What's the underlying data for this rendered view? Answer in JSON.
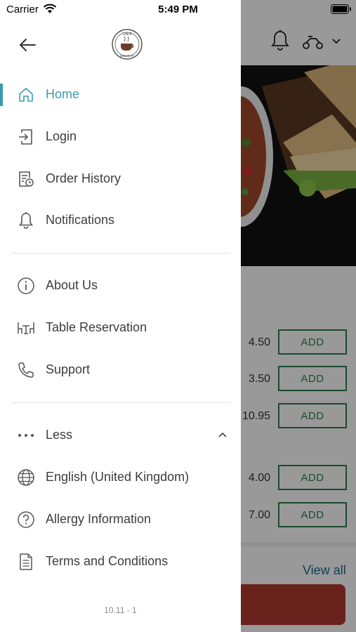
{
  "status_bar": {
    "carrier": "Carrier",
    "time": "5:49 PM"
  },
  "drawer": {
    "logo_text_top": "CAFE",
    "logo_text_bottom": "DELIGHT",
    "active_color": "#3a9bb0",
    "primary_items": [
      {
        "label": "Home",
        "icon": "home-icon",
        "active": true
      },
      {
        "label": "Login",
        "icon": "login-icon"
      },
      {
        "label": "Order History",
        "icon": "order-history-icon"
      },
      {
        "label": "Notifications",
        "icon": "bell-icon"
      }
    ],
    "secondary_items": [
      {
        "label": "About Us",
        "icon": "info-icon"
      },
      {
        "label": "Table Reservation",
        "icon": "table-icon"
      },
      {
        "label": "Support",
        "icon": "phone-icon"
      }
    ],
    "less_label": "Less",
    "tertiary_items": [
      {
        "label": "English (United Kingdom)",
        "icon": "globe-icon"
      },
      {
        "label": "Allergy Information",
        "icon": "question-icon"
      },
      {
        "label": "Terms and Conditions",
        "icon": "document-icon"
      }
    ],
    "version": "10.11 - 1"
  },
  "background": {
    "add_label": "ADD",
    "prices": [
      "4.50",
      "3.50",
      "10.95",
      "4.00",
      "7.00"
    ],
    "view_all": "View all",
    "add_color": "#2e7d4f",
    "cart_color": "#b03a2e"
  }
}
